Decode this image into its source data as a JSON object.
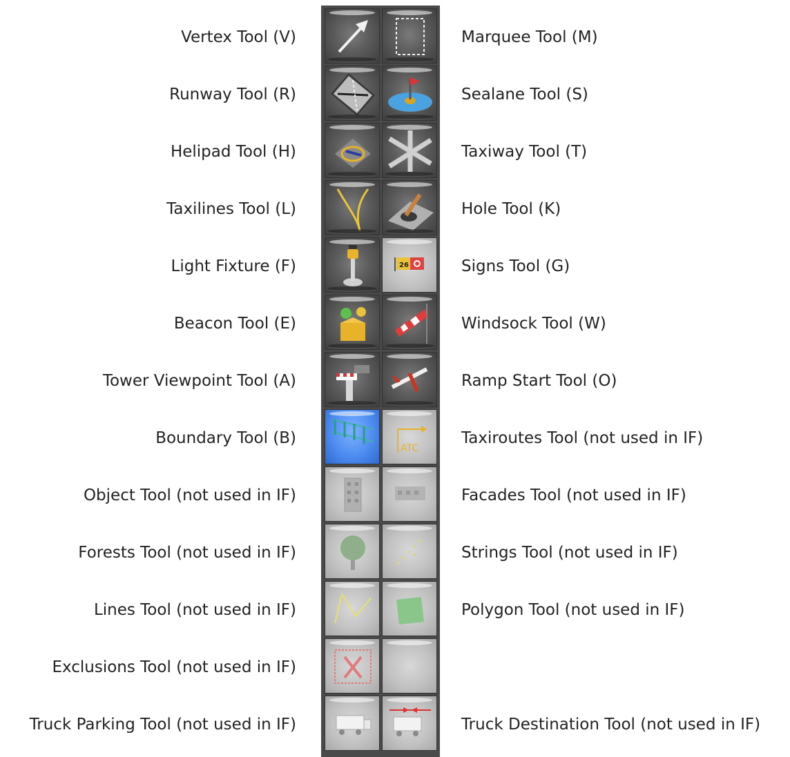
{
  "tools": [
    {
      "left": "Vertex Tool (V)",
      "right": "Marquee Tool (M)"
    },
    {
      "left": "Runway Tool (R)",
      "right": "Sealane Tool (S)"
    },
    {
      "left": "Helipad Tool (H)",
      "right": "Taxiway Tool (T)"
    },
    {
      "left": "Taxilines Tool (L)",
      "right": "Hole Tool (K)"
    },
    {
      "left": "Light Fixture (F)",
      "right": "Signs Tool (G)"
    },
    {
      "left": "Beacon Tool (E)",
      "right": "Windsock Tool (W)"
    },
    {
      "left": "Tower Viewpoint Tool (A)",
      "right": "Ramp Start Tool (O)"
    },
    {
      "left": "Boundary Tool (B)",
      "right": "Taxiroutes Tool (not used in IF)"
    },
    {
      "left": "Object Tool (not used in IF)",
      "right": "Facades Tool (not used in IF)"
    },
    {
      "left": "Forests Tool (not used in IF)",
      "right": "Strings Tool (not used in IF)"
    },
    {
      "left": "Lines Tool (not used in IF)",
      "right": "Polygon Tool (not used in IF)"
    },
    {
      "left": "Exclusions Tool (not used in IF)",
      "right": ""
    },
    {
      "left": "Truck Parking Tool (not used in IF)",
      "right": "Truck Destination Tool (not used in IF)"
    }
  ],
  "palette": {
    "selected_tool": "Boundary Tool (B)",
    "icon_text": {
      "signs": "26",
      "atc": "ATC"
    },
    "colors": {
      "selected": "#4d8cf0",
      "enabled": "#5c5c5c",
      "disabled": "#c2c2c2"
    }
  }
}
